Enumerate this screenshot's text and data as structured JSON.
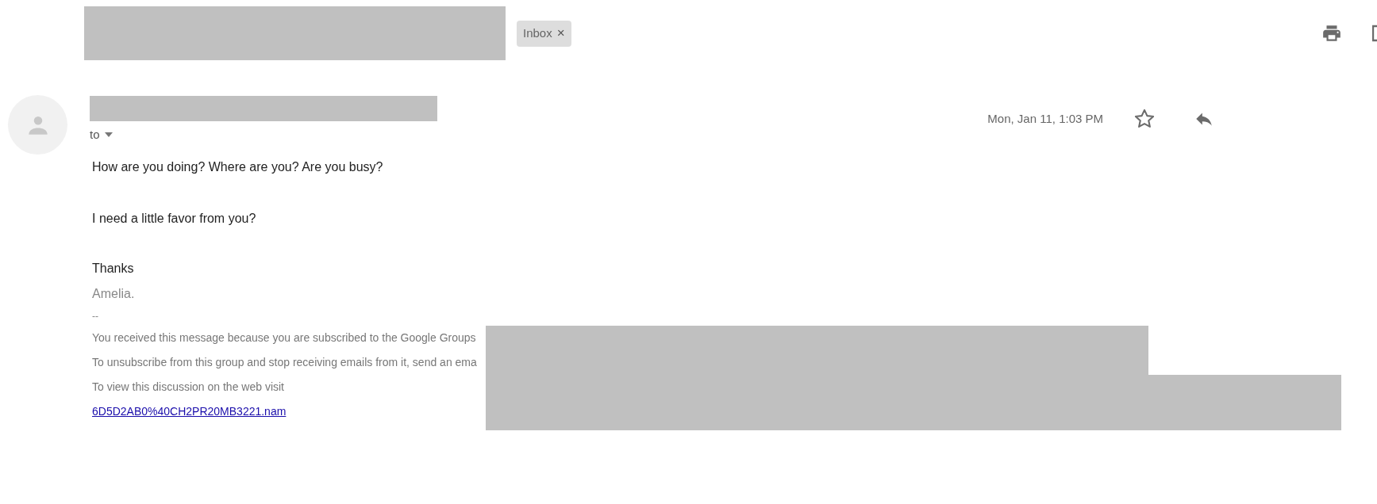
{
  "header": {
    "label_chip": {
      "label": "Inbox",
      "remove": "×"
    }
  },
  "message": {
    "recipient_label": "to",
    "date": "Mon, Jan 11, 1:03 PM",
    "starred": false,
    "body": [
      "How are you doing? Where are you? Are you busy?",
      "I need a little favor from you?"
    ],
    "closing": "Thanks",
    "signature": "Amelia.",
    "separator": "--",
    "footer": [
      "You received this message because you are subscribed to the Google Groups",
      "To unsubscribe from this group and stop receiving emails from it, send an ema",
      "To view this discussion on the web visit"
    ],
    "footer_link": "6D5D2AB0%40CH2PR20MB3221.nam"
  }
}
